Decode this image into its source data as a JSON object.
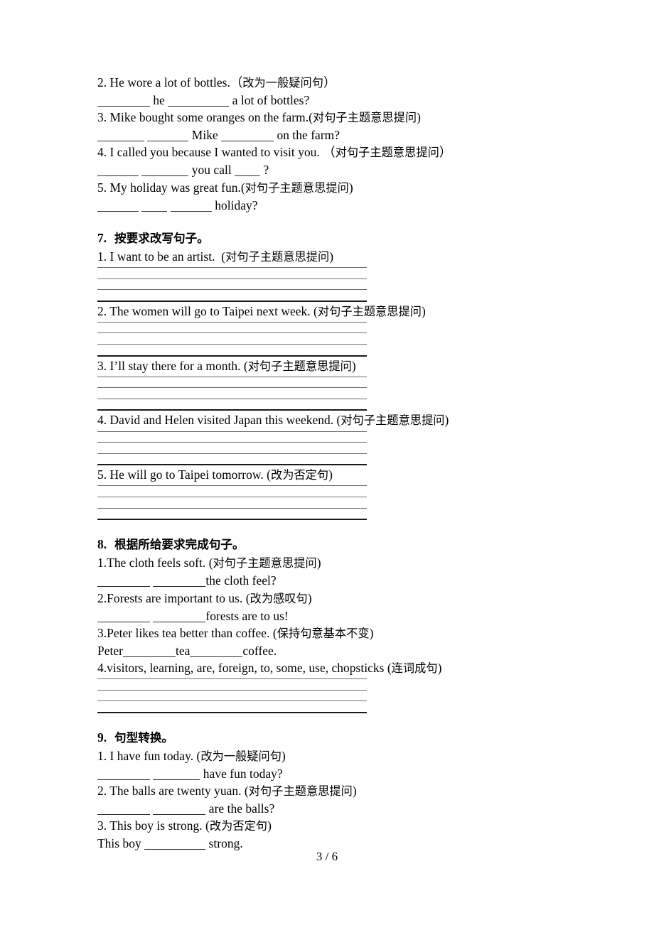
{
  "document": {
    "page_number": "3",
    "total_pages": "6",
    "footer": "3 / 6"
  },
  "blocks": [
    {
      "id": "section-6-continued",
      "type": "continued-items",
      "items": [
        {
          "prompt": "2. He wore a lot of bottles.（",
          "instruction": "改为一般疑问句",
          "prompt_tail": "）",
          "answer_parts": [
            "",
            " he ",
            " a lot of bottles?"
          ],
          "blank_sizes": [
            "b-l",
            "b-xl"
          ]
        },
        {
          "prompt": "3. Mike bought some oranges on the farm.(",
          "instruction": "对句子主题意思提问",
          "prompt_tail": ")",
          "answer_parts": [
            "",
            " ",
            " Mike ",
            " on the farm?"
          ],
          "blank_sizes": [
            "b-m",
            "b-s",
            "b-l"
          ]
        },
        {
          "prompt": "4. I called you because I wanted to visit you. （",
          "instruction": "对句子主题意思提问",
          "prompt_tail": "）",
          "answer_parts": [
            "",
            " ",
            " you call ",
            " ?"
          ],
          "blank_sizes": [
            "b-s",
            "b-m",
            "b-xs"
          ]
        },
        {
          "prompt": "5. My holiday was great fun.(",
          "instruction": "对句子主题意思提问",
          "prompt_tail": ")",
          "answer_parts": [
            "",
            " ",
            " ",
            " holiday?"
          ],
          "blank_sizes": [
            "b-s",
            "b-xs",
            "b-s"
          ]
        }
      ]
    },
    {
      "id": "section-7",
      "type": "section",
      "number": "7.",
      "title_cn": "按要求改写句子。",
      "items": [
        {
          "text": "1. I want to be an artist.  (",
          "instruction": "对句子主题意思提问",
          "tail": ")",
          "rules": 4
        },
        {
          "text": "2. The women will go to Taipei next week. (",
          "instruction": "对句子主题意思提问",
          "tail": ")",
          "rules": 4
        },
        {
          "text": "3. I’ll stay there for a month. (",
          "instruction": "对句子主题意思提问",
          "tail": ")",
          "rules": 4
        },
        {
          "text": "4. David and Helen visited Japan this weekend. (",
          "instruction": "对句子主题意思提问",
          "tail": ")",
          "rules": 4
        },
        {
          "text": "5. He will go to Taipei tomorrow. (",
          "instruction": "改为否定句",
          "tail": ")",
          "rules": 4
        }
      ]
    },
    {
      "id": "section-8",
      "type": "section",
      "number": "8.",
      "title_cn": "根据所给要求完成句子。",
      "items": [
        {
          "prompt": "1.The cloth feels soft. (",
          "instruction": "对句子主题意思提问",
          "prompt_tail": ")",
          "answer_parts": [
            "",
            " ",
            "the cloth feel?"
          ],
          "blank_sizes": [
            "b-l",
            "b-l"
          ]
        },
        {
          "prompt": "2.Forests are important to us. (",
          "instruction": "改为感叹句",
          "prompt_tail": ")",
          "answer_parts": [
            "",
            " ",
            "forests are to us!"
          ],
          "blank_sizes": [
            "b-l",
            "b-l"
          ]
        },
        {
          "prompt": "3.Peter likes tea better than coffee. (",
          "instruction": "保持句意基本不变",
          "prompt_tail": ")",
          "answer_parts": [
            "Peter",
            "tea",
            "coffee."
          ],
          "blank_sizes": [
            "b-l",
            "b-l"
          ]
        },
        {
          "prompt": "4.visitors, learning, are, foreign, to, some, use, chopsticks (",
          "instruction": "连词成句",
          "prompt_tail": ")",
          "rules": 4
        }
      ]
    },
    {
      "id": "section-9",
      "type": "section",
      "number": "9.",
      "title_cn": "句型转换。",
      "items": [
        {
          "prompt": "1. I have fun today. (",
          "instruction": "改为一般疑问句",
          "prompt_tail": ")",
          "answer_parts": [
            "",
            " ",
            " have fun today?"
          ],
          "blank_sizes": [
            "b-l",
            "b-m"
          ]
        },
        {
          "prompt": "2. The balls are twenty yuan. (",
          "instruction": "对句子主题意思提问",
          "prompt_tail": ")",
          "answer_parts": [
            "",
            " ",
            " are the balls?"
          ],
          "blank_sizes": [
            "b-l",
            "b-l"
          ]
        },
        {
          "prompt": "3. This boy is strong. (",
          "instruction": "改为否定句",
          "prompt_tail": ")",
          "answer_parts": [
            "This boy ",
            " strong."
          ],
          "blank_sizes": [
            "b-xl"
          ]
        }
      ]
    }
  ]
}
